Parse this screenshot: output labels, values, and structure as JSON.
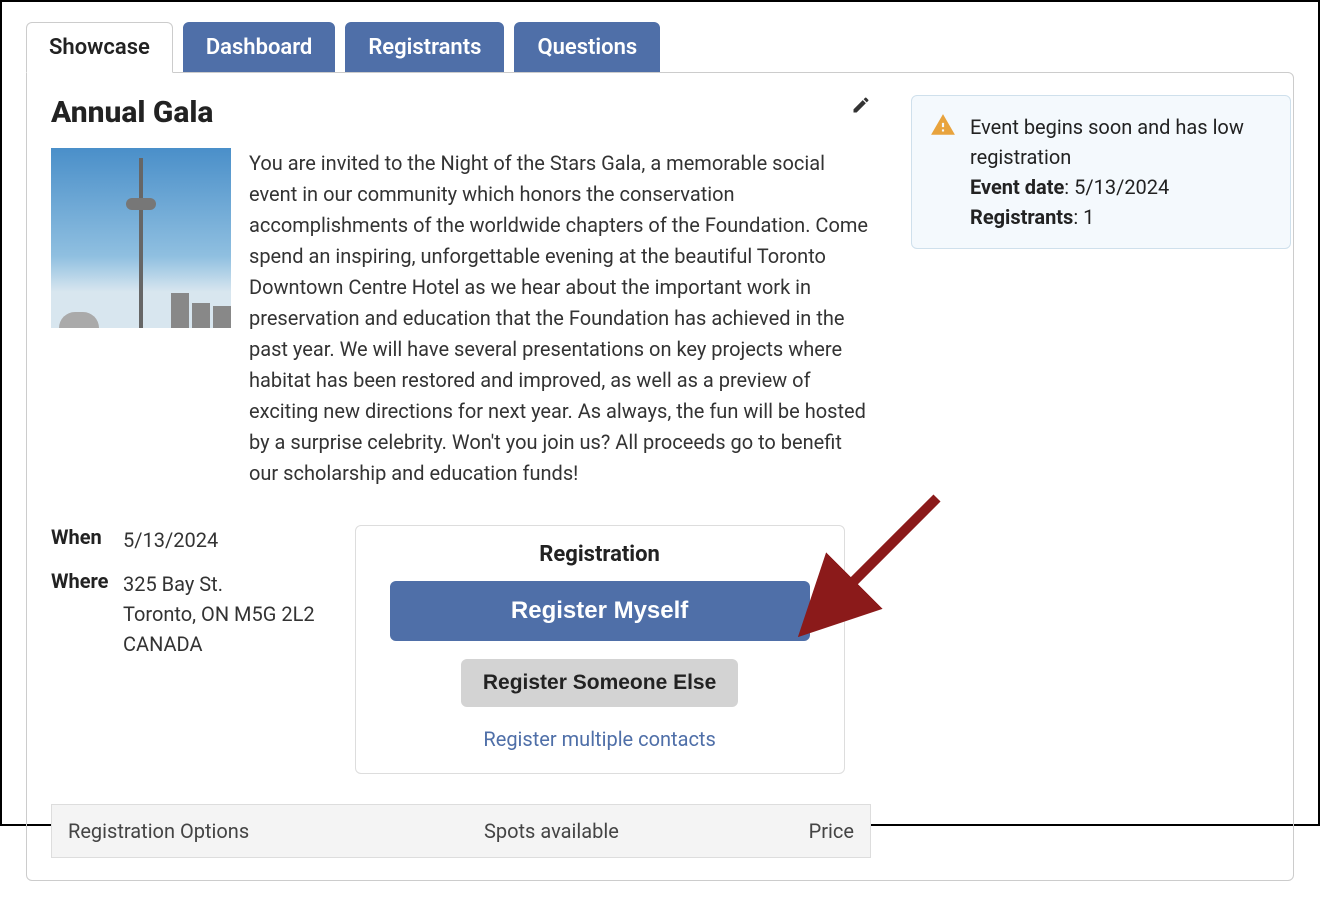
{
  "tabs": {
    "showcase": "Showcase",
    "dashboard": "Dashboard",
    "registrants": "Registrants",
    "questions": "Questions"
  },
  "event": {
    "title": "Annual Gala",
    "description": "You are invited to the Night of the Stars Gala, a memorable social event in our community which honors the conservation accomplishments of the worldwide chapters of the Foundation. Come spend an inspiring, unforgettable evening at the beautiful Toronto Downtown Centre Hotel as we hear about the important work in preservation and education that the Foundation has achieved in the past year. We will have several presentations on key projects where habitat has been restored and improved, as well as a preview of exciting new directions for next year. As always, the fun will be hosted by a surprise celebrity. Won't you join us? All proceeds go to benefit our scholarship and education funds!"
  },
  "info": {
    "when_label": "When",
    "when_value": "5/13/2024",
    "where_label": "Where",
    "where_line1": "325 Bay St.",
    "where_line2": "Toronto, ON M5G 2L2",
    "where_line3": "CANADA"
  },
  "registration": {
    "title": "Registration",
    "register_myself": "Register Myself",
    "register_someone_else": "Register Someone Else",
    "register_multiple": "Register multiple contacts"
  },
  "alert": {
    "message": "Event begins soon and has low registration",
    "event_date_label": "Event date",
    "event_date_value": "5/13/2024",
    "registrants_label": "Registrants",
    "registrants_value": "1"
  },
  "options_table": {
    "col_options": "Registration Options",
    "col_spots": "Spots available",
    "col_price": "Price"
  }
}
